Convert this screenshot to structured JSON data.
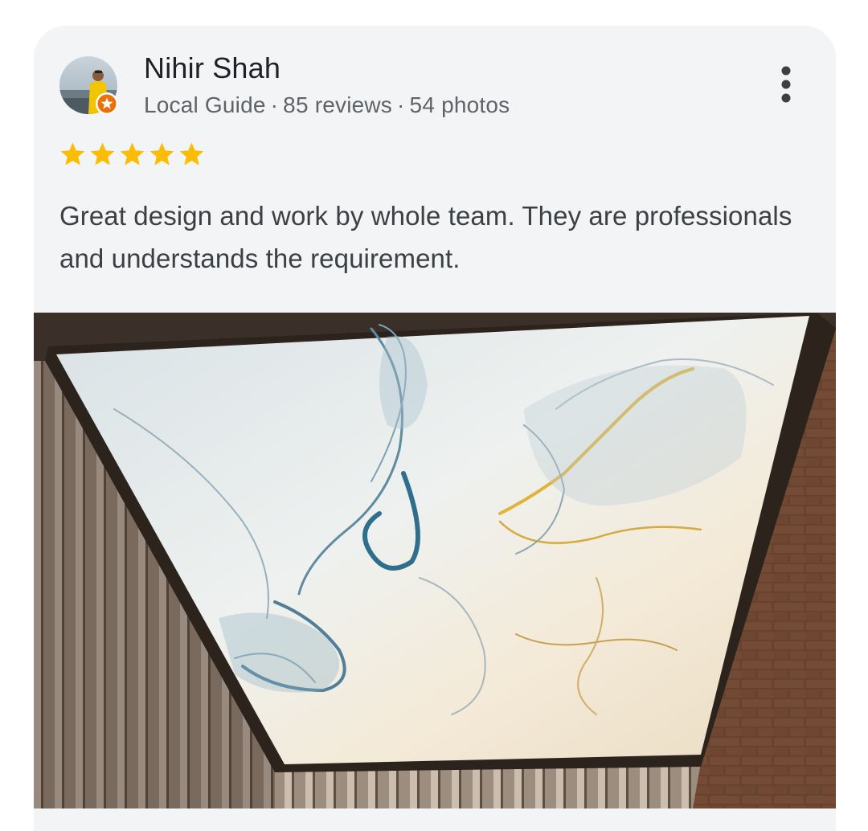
{
  "review": {
    "author_name": "Nihir Shah",
    "author_badge": "Local Guide",
    "reviews_count": "85 reviews",
    "photos_count": "54 photos",
    "separator": "·",
    "rating": 5,
    "text": "Great design and work by whole team. They are professionals and understands the requirement.",
    "more_icon": "more-vert-icon",
    "star_color": "#fbbc04",
    "badge_color": "#e8710a"
  }
}
